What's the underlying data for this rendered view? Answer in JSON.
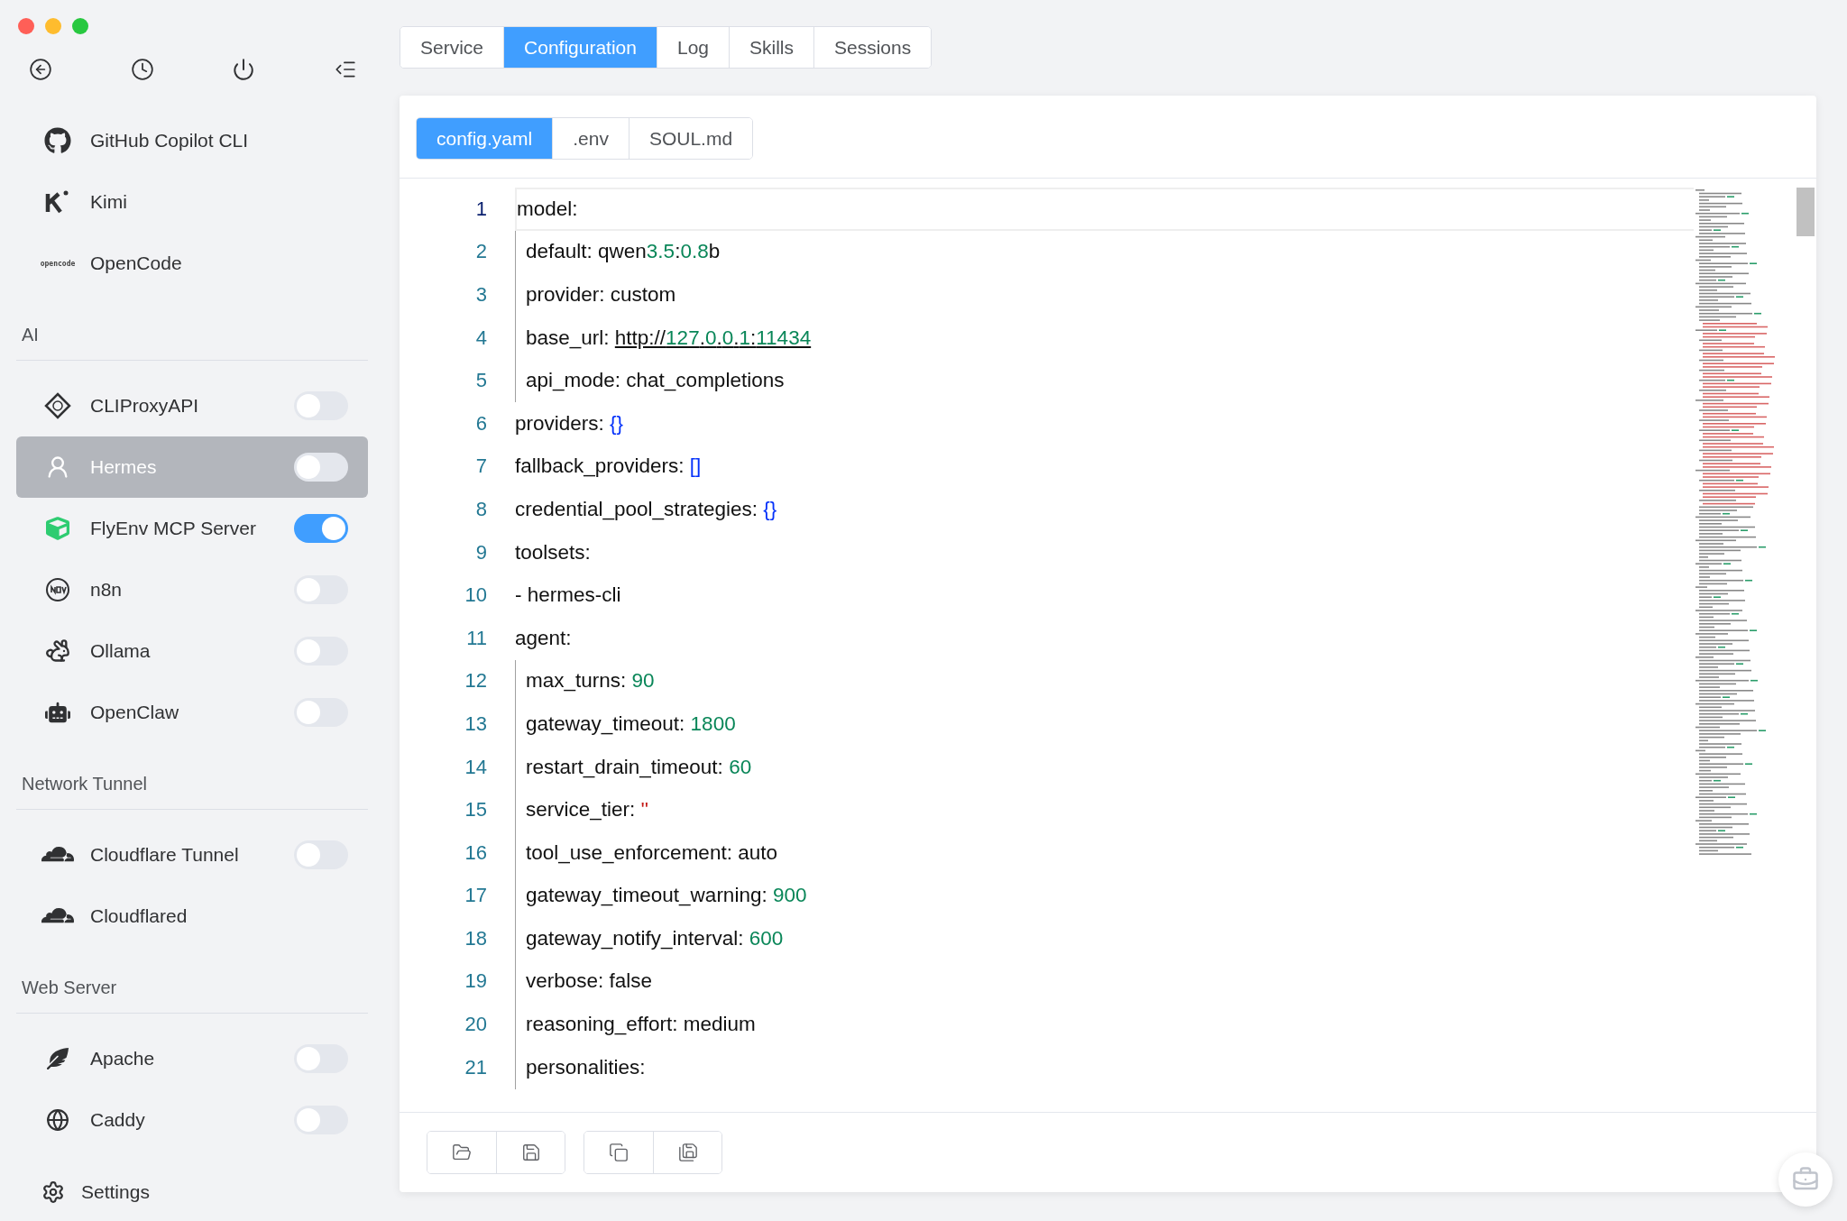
{
  "sidebar": {
    "apps": [
      {
        "label": "GitHub Copilot CLI",
        "selected": false
      },
      {
        "label": "Kimi",
        "selected": false
      },
      {
        "label": "OpenCode",
        "selected": false,
        "logo_text": "opencode"
      }
    ],
    "sections": [
      {
        "title": "AI",
        "items": [
          {
            "label": "CLIProxyAPI",
            "kind": "toggle",
            "on": false,
            "selected": false
          },
          {
            "label": "Hermes",
            "kind": "toggle",
            "on": false,
            "selected": true
          },
          {
            "label": "FlyEnv MCP Server",
            "kind": "toggle",
            "on": true,
            "selected": false
          },
          {
            "label": "n8n",
            "kind": "toggle",
            "on": false,
            "selected": false
          },
          {
            "label": "Ollama",
            "kind": "toggle",
            "on": false,
            "selected": false
          },
          {
            "label": "OpenClaw",
            "kind": "toggle",
            "on": false,
            "selected": false
          }
        ]
      },
      {
        "title": "Network Tunnel",
        "items": [
          {
            "label": "Cloudflare Tunnel",
            "kind": "toggle",
            "on": false,
            "selected": false
          },
          {
            "label": "Cloudflared",
            "kind": "plain",
            "selected": false
          }
        ]
      },
      {
        "title": "Web Server",
        "items": [
          {
            "label": "Apache",
            "kind": "toggle",
            "on": false,
            "selected": false
          },
          {
            "label": "Caddy",
            "kind": "toggle",
            "on": false,
            "selected": false
          }
        ]
      }
    ],
    "settings": "Settings"
  },
  "tabs": [
    {
      "label": "Service",
      "selected": false
    },
    {
      "label": "Configuration",
      "selected": true
    },
    {
      "label": "Log",
      "selected": false
    },
    {
      "label": "Skills",
      "selected": false
    },
    {
      "label": "Sessions",
      "selected": false
    }
  ],
  "file_tabs": [
    {
      "label": "config.yaml",
      "selected": true
    },
    {
      "label": ".env",
      "selected": false
    },
    {
      "label": "SOUL.md",
      "selected": false
    }
  ],
  "editor": {
    "lines": [
      {
        "number": "1",
        "current": true,
        "tokens": [
          {
            "kind": "plain",
            "text": "model:"
          }
        ],
        "children": [
          {
            "number": "2",
            "current": false,
            "tokens": [
              {
                "kind": "plain",
                "text": "default: qwen"
              },
              {
                "kind": "number",
                "text": "3.5"
              },
              {
                "kind": "plain",
                "text": ":"
              },
              {
                "kind": "number",
                "text": "0.8"
              },
              {
                "kind": "plain",
                "text": "b"
              }
            ]
          },
          {
            "number": "3",
            "current": false,
            "tokens": [
              {
                "kind": "plain",
                "text": "provider: custom"
              }
            ]
          },
          {
            "number": "4",
            "current": false,
            "tokens": [
              {
                "kind": "plain",
                "text": "base_url: "
              },
              {
                "kind": "link",
                "parts": [
                  {
                    "kind": "plain",
                    "text": "http://"
                  },
                  {
                    "kind": "number",
                    "text": "127"
                  },
                  {
                    "kind": "plain",
                    "text": "."
                  },
                  {
                    "kind": "number",
                    "text": "0"
                  },
                  {
                    "kind": "plain",
                    "text": "."
                  },
                  {
                    "kind": "number",
                    "text": "0"
                  },
                  {
                    "kind": "plain",
                    "text": "."
                  },
                  {
                    "kind": "number",
                    "text": "1"
                  },
                  {
                    "kind": "plain",
                    "text": ":"
                  },
                  {
                    "kind": "number",
                    "text": "11434"
                  }
                ]
              }
            ]
          },
          {
            "number": "5",
            "current": false,
            "tokens": [
              {
                "kind": "plain",
                "text": "api_mode: chat_completions"
              }
            ]
          }
        ]
      },
      {
        "number": "6",
        "current": false,
        "tokens": [
          {
            "kind": "plain",
            "text": "providers: "
          },
          {
            "kind": "bracket",
            "text": "{}"
          }
        ]
      },
      {
        "number": "7",
        "current": false,
        "tokens": [
          {
            "kind": "plain",
            "text": "fallback_providers: "
          },
          {
            "kind": "bracket",
            "text": "[]"
          }
        ]
      },
      {
        "number": "8",
        "current": false,
        "tokens": [
          {
            "kind": "plain",
            "text": "credential_pool_strategies: "
          },
          {
            "kind": "bracket",
            "text": "{}"
          }
        ]
      },
      {
        "number": "9",
        "current": false,
        "tokens": [
          {
            "kind": "plain",
            "text": "toolsets:"
          }
        ]
      },
      {
        "number": "10",
        "current": false,
        "tokens": [
          {
            "kind": "plain",
            "text": "- hermes-cli"
          }
        ]
      },
      {
        "number": "11",
        "current": false,
        "tokens": [
          {
            "kind": "plain",
            "text": "agent:"
          }
        ],
        "children": [
          {
            "number": "12",
            "current": false,
            "tokens": [
              {
                "kind": "plain",
                "text": "max_turns: "
              },
              {
                "kind": "number",
                "text": "90"
              }
            ]
          },
          {
            "number": "13",
            "current": false,
            "tokens": [
              {
                "kind": "plain",
                "text": "gateway_timeout: "
              },
              {
                "kind": "number",
                "text": "1800"
              }
            ]
          },
          {
            "number": "14",
            "current": false,
            "tokens": [
              {
                "kind": "plain",
                "text": "restart_drain_timeout: "
              },
              {
                "kind": "number",
                "text": "60"
              }
            ]
          },
          {
            "number": "15",
            "current": false,
            "tokens": [
              {
                "kind": "plain",
                "text": "service_tier: "
              },
              {
                "kind": "string",
                "text": "''"
              }
            ]
          },
          {
            "number": "16",
            "current": false,
            "tokens": [
              {
                "kind": "plain",
                "text": "tool_use_enforcement: auto"
              }
            ]
          },
          {
            "number": "17",
            "current": false,
            "tokens": [
              {
                "kind": "plain",
                "text": "gateway_timeout_warning: "
              },
              {
                "kind": "number",
                "text": "900"
              }
            ]
          },
          {
            "number": "18",
            "current": false,
            "tokens": [
              {
                "kind": "plain",
                "text": "gateway_notify_interval: "
              },
              {
                "kind": "number",
                "text": "600"
              }
            ]
          },
          {
            "number": "19",
            "current": false,
            "tokens": [
              {
                "kind": "plain",
                "text": "verbose: false"
              }
            ]
          },
          {
            "number": "20",
            "current": false,
            "tokens": [
              {
                "kind": "plain",
                "text": "reasoning_effort: medium"
              }
            ]
          },
          {
            "number": "21",
            "current": false,
            "tokens": [
              {
                "kind": "plain",
                "text": "personalities:"
              }
            ]
          }
        ]
      }
    ]
  }
}
